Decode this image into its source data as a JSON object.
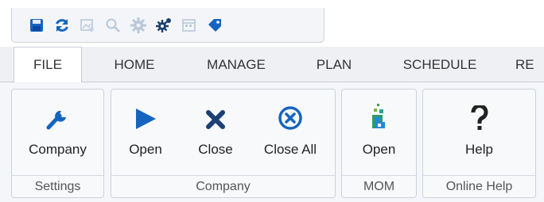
{
  "quick_access": {
    "icons": [
      "save-icon",
      "refresh-icon",
      "picture-disabled-icon",
      "search-disabled-icon",
      "settings-disabled-icon",
      "gears-icon",
      "calendar-disabled-icon",
      "tag-icon"
    ]
  },
  "tabs": [
    "FILE",
    "HOME",
    "MANAGE",
    "PLAN",
    "SCHEDULE",
    "RE"
  ],
  "ribbon": {
    "settings": {
      "label": "Settings",
      "company": "Company"
    },
    "company": {
      "label": "Company",
      "open": "Open",
      "close": "Close",
      "close_all": "Close All"
    },
    "mom": {
      "label": "MOM",
      "open": "Open"
    },
    "online_help": {
      "label": "Online Help",
      "help": "Help"
    }
  },
  "colors": {
    "accent": "#1565c0",
    "close_x": "#1d3f73",
    "tab_strip": "#eef0f3"
  }
}
